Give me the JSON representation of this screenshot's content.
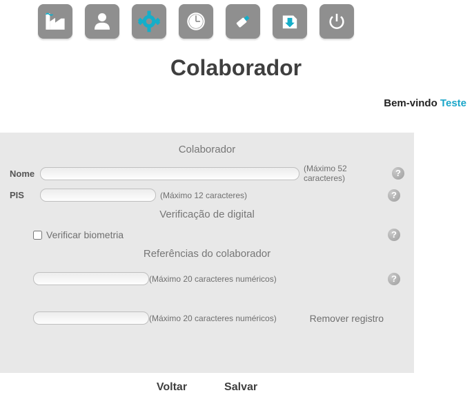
{
  "page_title": "Colaborador",
  "welcome_prefix": "Bem-vindo ",
  "welcome_user": "Teste",
  "panel": {
    "section_colaborador": "Colaborador",
    "label_nome": "Nome",
    "hint_nome": "(Máximo 52 caracteres)",
    "label_pis": "PIS",
    "hint_pis": "(Máximo 12 caracteres)",
    "section_digital": "Verificação de digital",
    "checkbox_biometria": "Verificar biometria",
    "section_referencias": "Referências do colaborador",
    "hint_ref": "(Máximo 20 caracteres numéricos)",
    "remove_registro": "Remover registro"
  },
  "footer": {
    "voltar": "Voltar",
    "salvar": "Salvar"
  },
  "help_glyph": "?"
}
